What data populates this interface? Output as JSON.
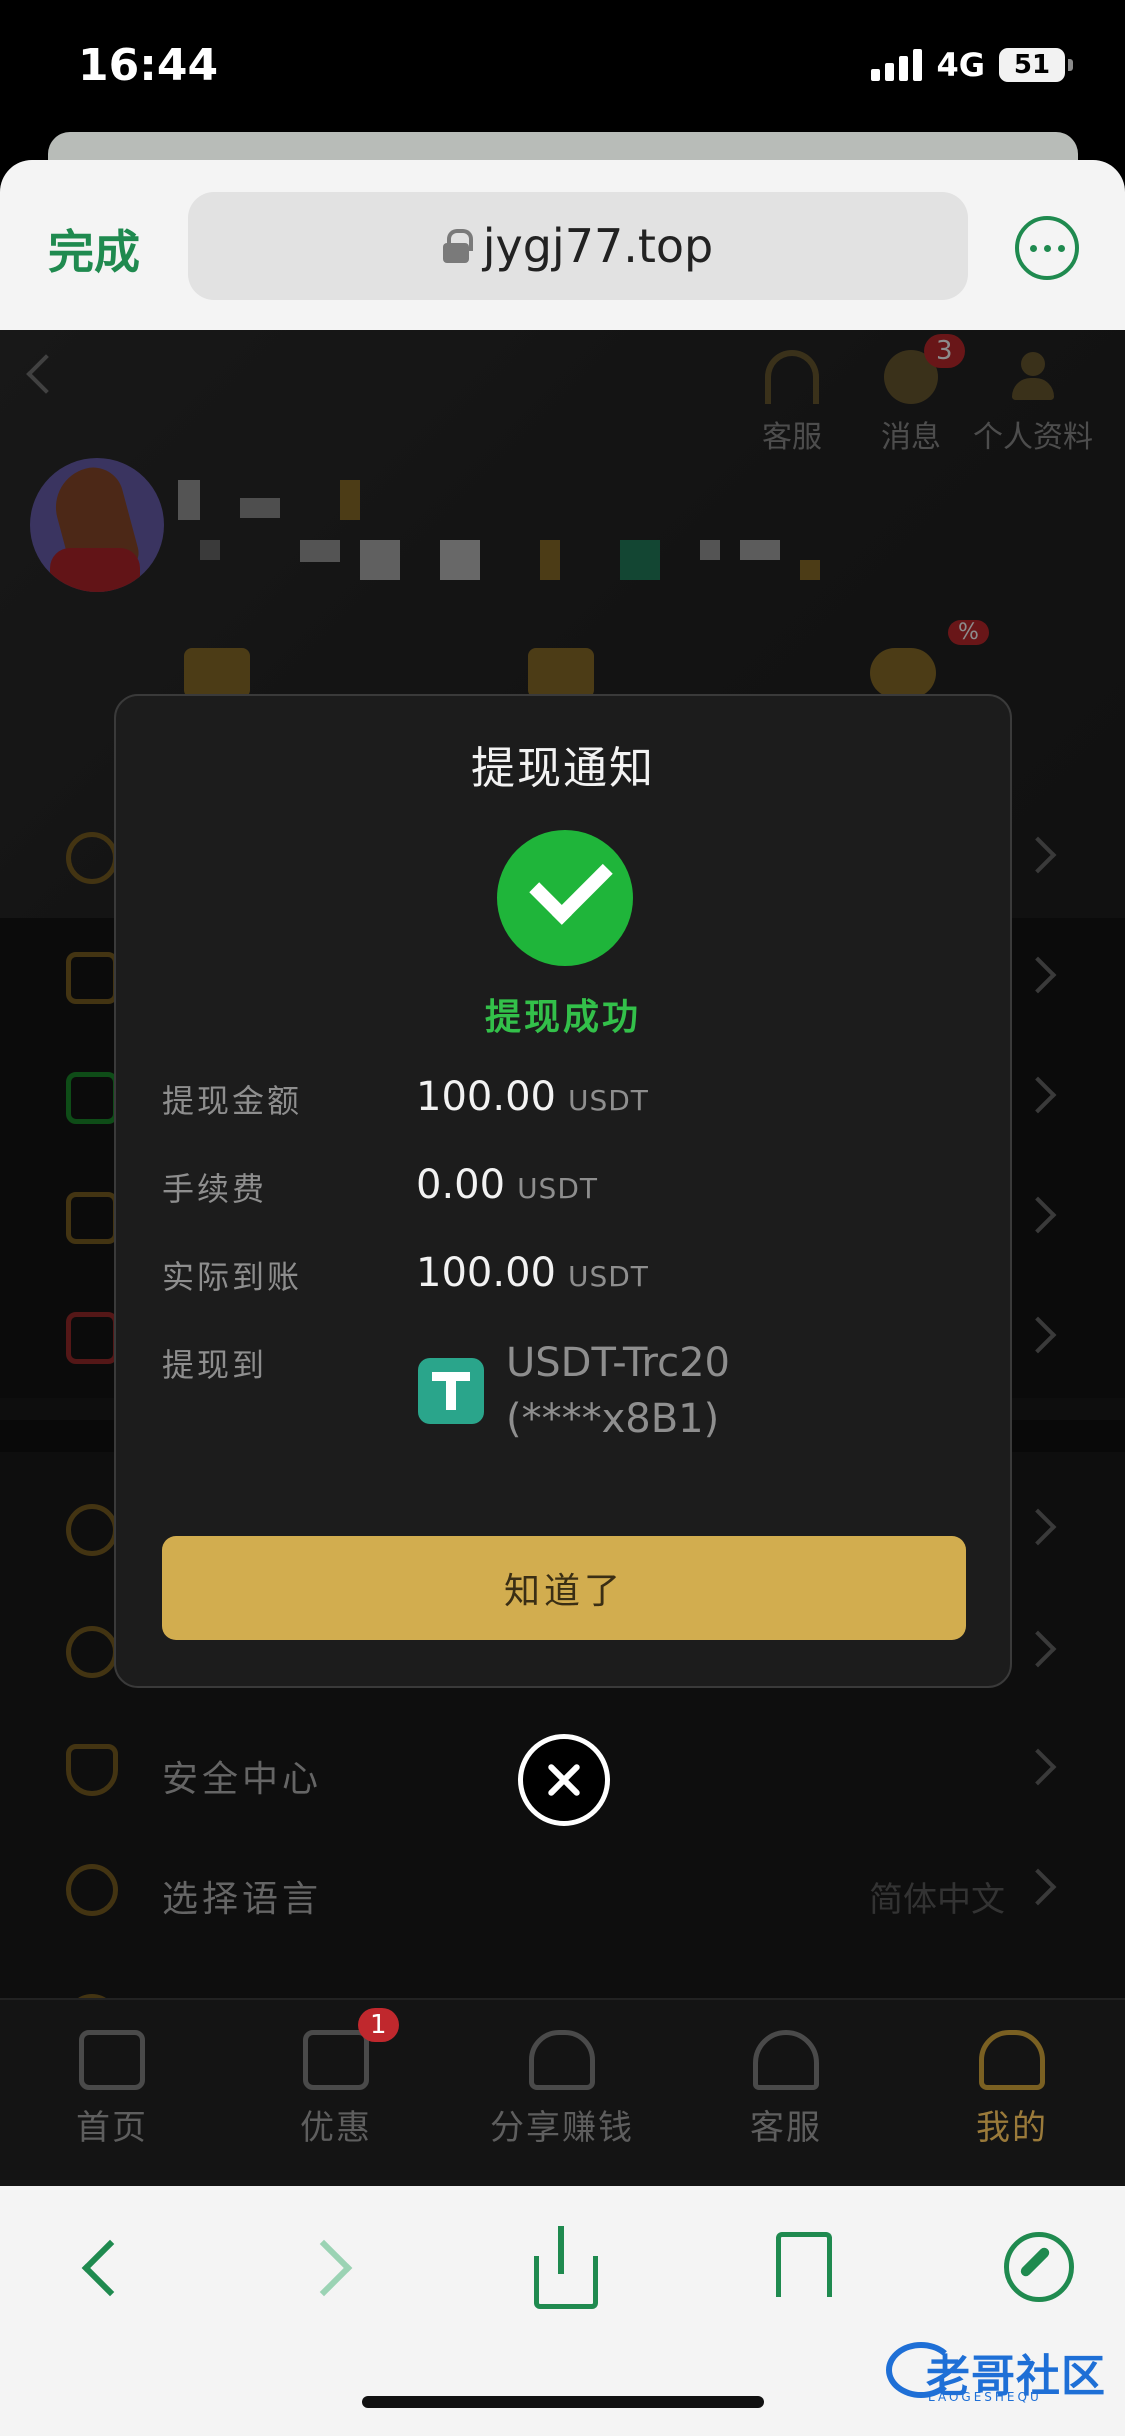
{
  "status_bar": {
    "time": "16:44",
    "network": "4G",
    "battery": "51"
  },
  "browser": {
    "done_label": "完成",
    "url": "jygj77.top"
  },
  "header": {
    "actions": [
      {
        "label": "客服",
        "icon": "headset-icon"
      },
      {
        "label": "消息",
        "icon": "chat-icon",
        "badge": "3"
      },
      {
        "label": "个人资料",
        "icon": "person-settings-icon"
      }
    ],
    "discount_badge": "%"
  },
  "menu": {
    "items": [
      {
        "label": "安全中心",
        "icon": "shield-icon"
      },
      {
        "label": "选择语言",
        "icon": "globe-icon",
        "value": "简体中文"
      }
    ]
  },
  "modal": {
    "title": "提现通知",
    "status": "提现成功",
    "rows": [
      {
        "label": "提现金额",
        "value": "100.00",
        "unit": "USDT"
      },
      {
        "label": "手续费",
        "value": "0.00",
        "unit": "USDT"
      },
      {
        "label": "实际到账",
        "value": "100.00",
        "unit": "USDT"
      }
    ],
    "destination_label": "提现到",
    "destination_name": "USDT-Trc20",
    "destination_account": "(****x8B1)",
    "ok_label": "知道了"
  },
  "tabbar": {
    "tabs": [
      {
        "label": "首页",
        "icon": "home-icon"
      },
      {
        "label": "优惠",
        "icon": "gift-icon",
        "badge": "1"
      },
      {
        "label": "分享赚钱",
        "icon": "share-people-icon"
      },
      {
        "label": "客服",
        "icon": "headset-icon"
      },
      {
        "label": "我的",
        "icon": "user-icon",
        "active": true
      }
    ]
  },
  "watermark": {
    "text": "老哥社区",
    "sub": "LAOGESHEQU"
  },
  "colors": {
    "accent_green": "#1f8a4f",
    "gold": "#d2ad4f",
    "success": "#1fb53a"
  }
}
